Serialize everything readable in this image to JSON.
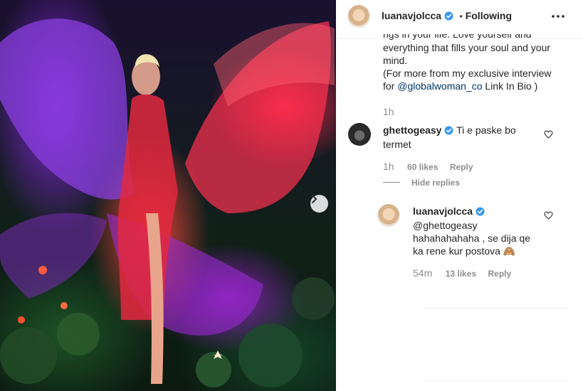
{
  "post": {
    "owner": "luanavjolcca",
    "bullet": "•",
    "follow_status": "Following",
    "caption_cut_line": "ngs in your life. Love yourself and",
    "caption_line1": "everything that fills your soul and your",
    "caption_line2": "mind.",
    "caption_line3": "(For more from my exclusive interview",
    "caption_line4_prefix": "for ",
    "caption_mention": "@globalwoman_co",
    "caption_line4_suffix": " Link In Bio )",
    "caption_time": "1h"
  },
  "comments": [
    {
      "user": "ghettogeasy",
      "text_line1": "Ti e paske bo",
      "text_line2": "termet",
      "time": "1h",
      "likes": "60 likes",
      "reply": "Reply"
    }
  ],
  "hide_replies": "Hide replies",
  "reply_comment": {
    "user": "luanavjolcca",
    "mention": "@ghettogeasy",
    "text_line1": "hahahahahaha , se dija qe",
    "text_line2": "ka rene kur postova 🙈",
    "time": "54m",
    "likes": "13 likes",
    "reply": "Reply"
  },
  "icons": {
    "more": "more-options-icon",
    "next": "chevron-right-icon",
    "heart": "heart-outline-icon",
    "verified": "verified-badge-icon"
  },
  "colors": {
    "verified_blue": "#3897f0",
    "mention_blue": "#003569",
    "meta_gray": "#8e8e8e"
  }
}
